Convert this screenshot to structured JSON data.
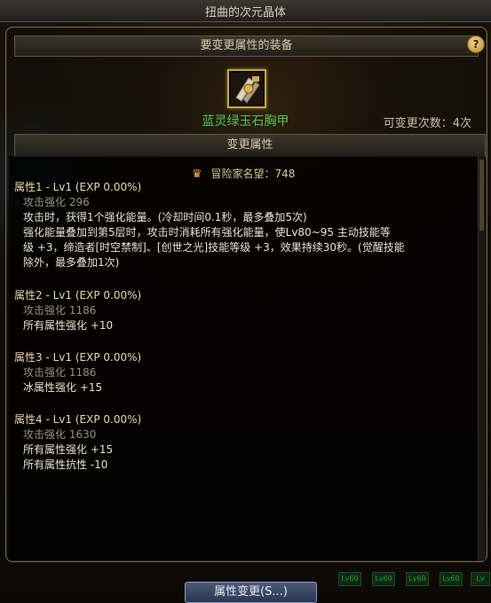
{
  "window": {
    "title": "扭曲的次元晶体"
  },
  "header": {
    "equip_title": "要变更属性的装备",
    "help_label": "?"
  },
  "item": {
    "name": "蓝灵绿玉石胸甲",
    "change_count": "可变更次数：4次",
    "icon": "chestplate-icon"
  },
  "section": {
    "change_title": "变更属性"
  },
  "fame": {
    "label": "冒险家名望：748",
    "icon": "crown-icon"
  },
  "properties": [
    {
      "title": "属性1 - Lv1 (EXP 0.00%)",
      "sub": "攻击强化 296",
      "lines": [
        "攻击时，获得1个强化能量。(冷却时间0.1秒，最多叠加5次)",
        "强化能量叠加到第5层时，攻击时消耗所有强化能量，使Lv80~95 主动技能等",
        "级 +3，缔造者[时空禁制]、[创世之光]技能等级 +3，效果持续30秒。(觉醒技能",
        "除外，最多叠加1次)"
      ]
    },
    {
      "title": "属性2 - Lv1 (EXP 0.00%)",
      "sub": "攻击强化 1186",
      "lines": [
        "所有属性强化 +10"
      ]
    },
    {
      "title": "属性3 - Lv1 (EXP 0.00%)",
      "sub": "攻击强化 1186",
      "lines": [
        "冰属性强化 +15"
      ]
    },
    {
      "title": "属性4 - Lv1 (EXP 0.00%)",
      "sub": "攻击强化 1630",
      "lines": [
        "所有属性强化 +15",
        "所有属性抗性 -10"
      ]
    }
  ],
  "footer": {
    "button_label": "属性变更(S...)"
  },
  "background_chips": [
    "Lv60",
    "Lv60",
    "Lv60",
    "Lv60",
    "Lv"
  ],
  "colors": {
    "item_name": "#57c04f",
    "gold": "#e2b449",
    "title_text": "#e9d9a8"
  }
}
